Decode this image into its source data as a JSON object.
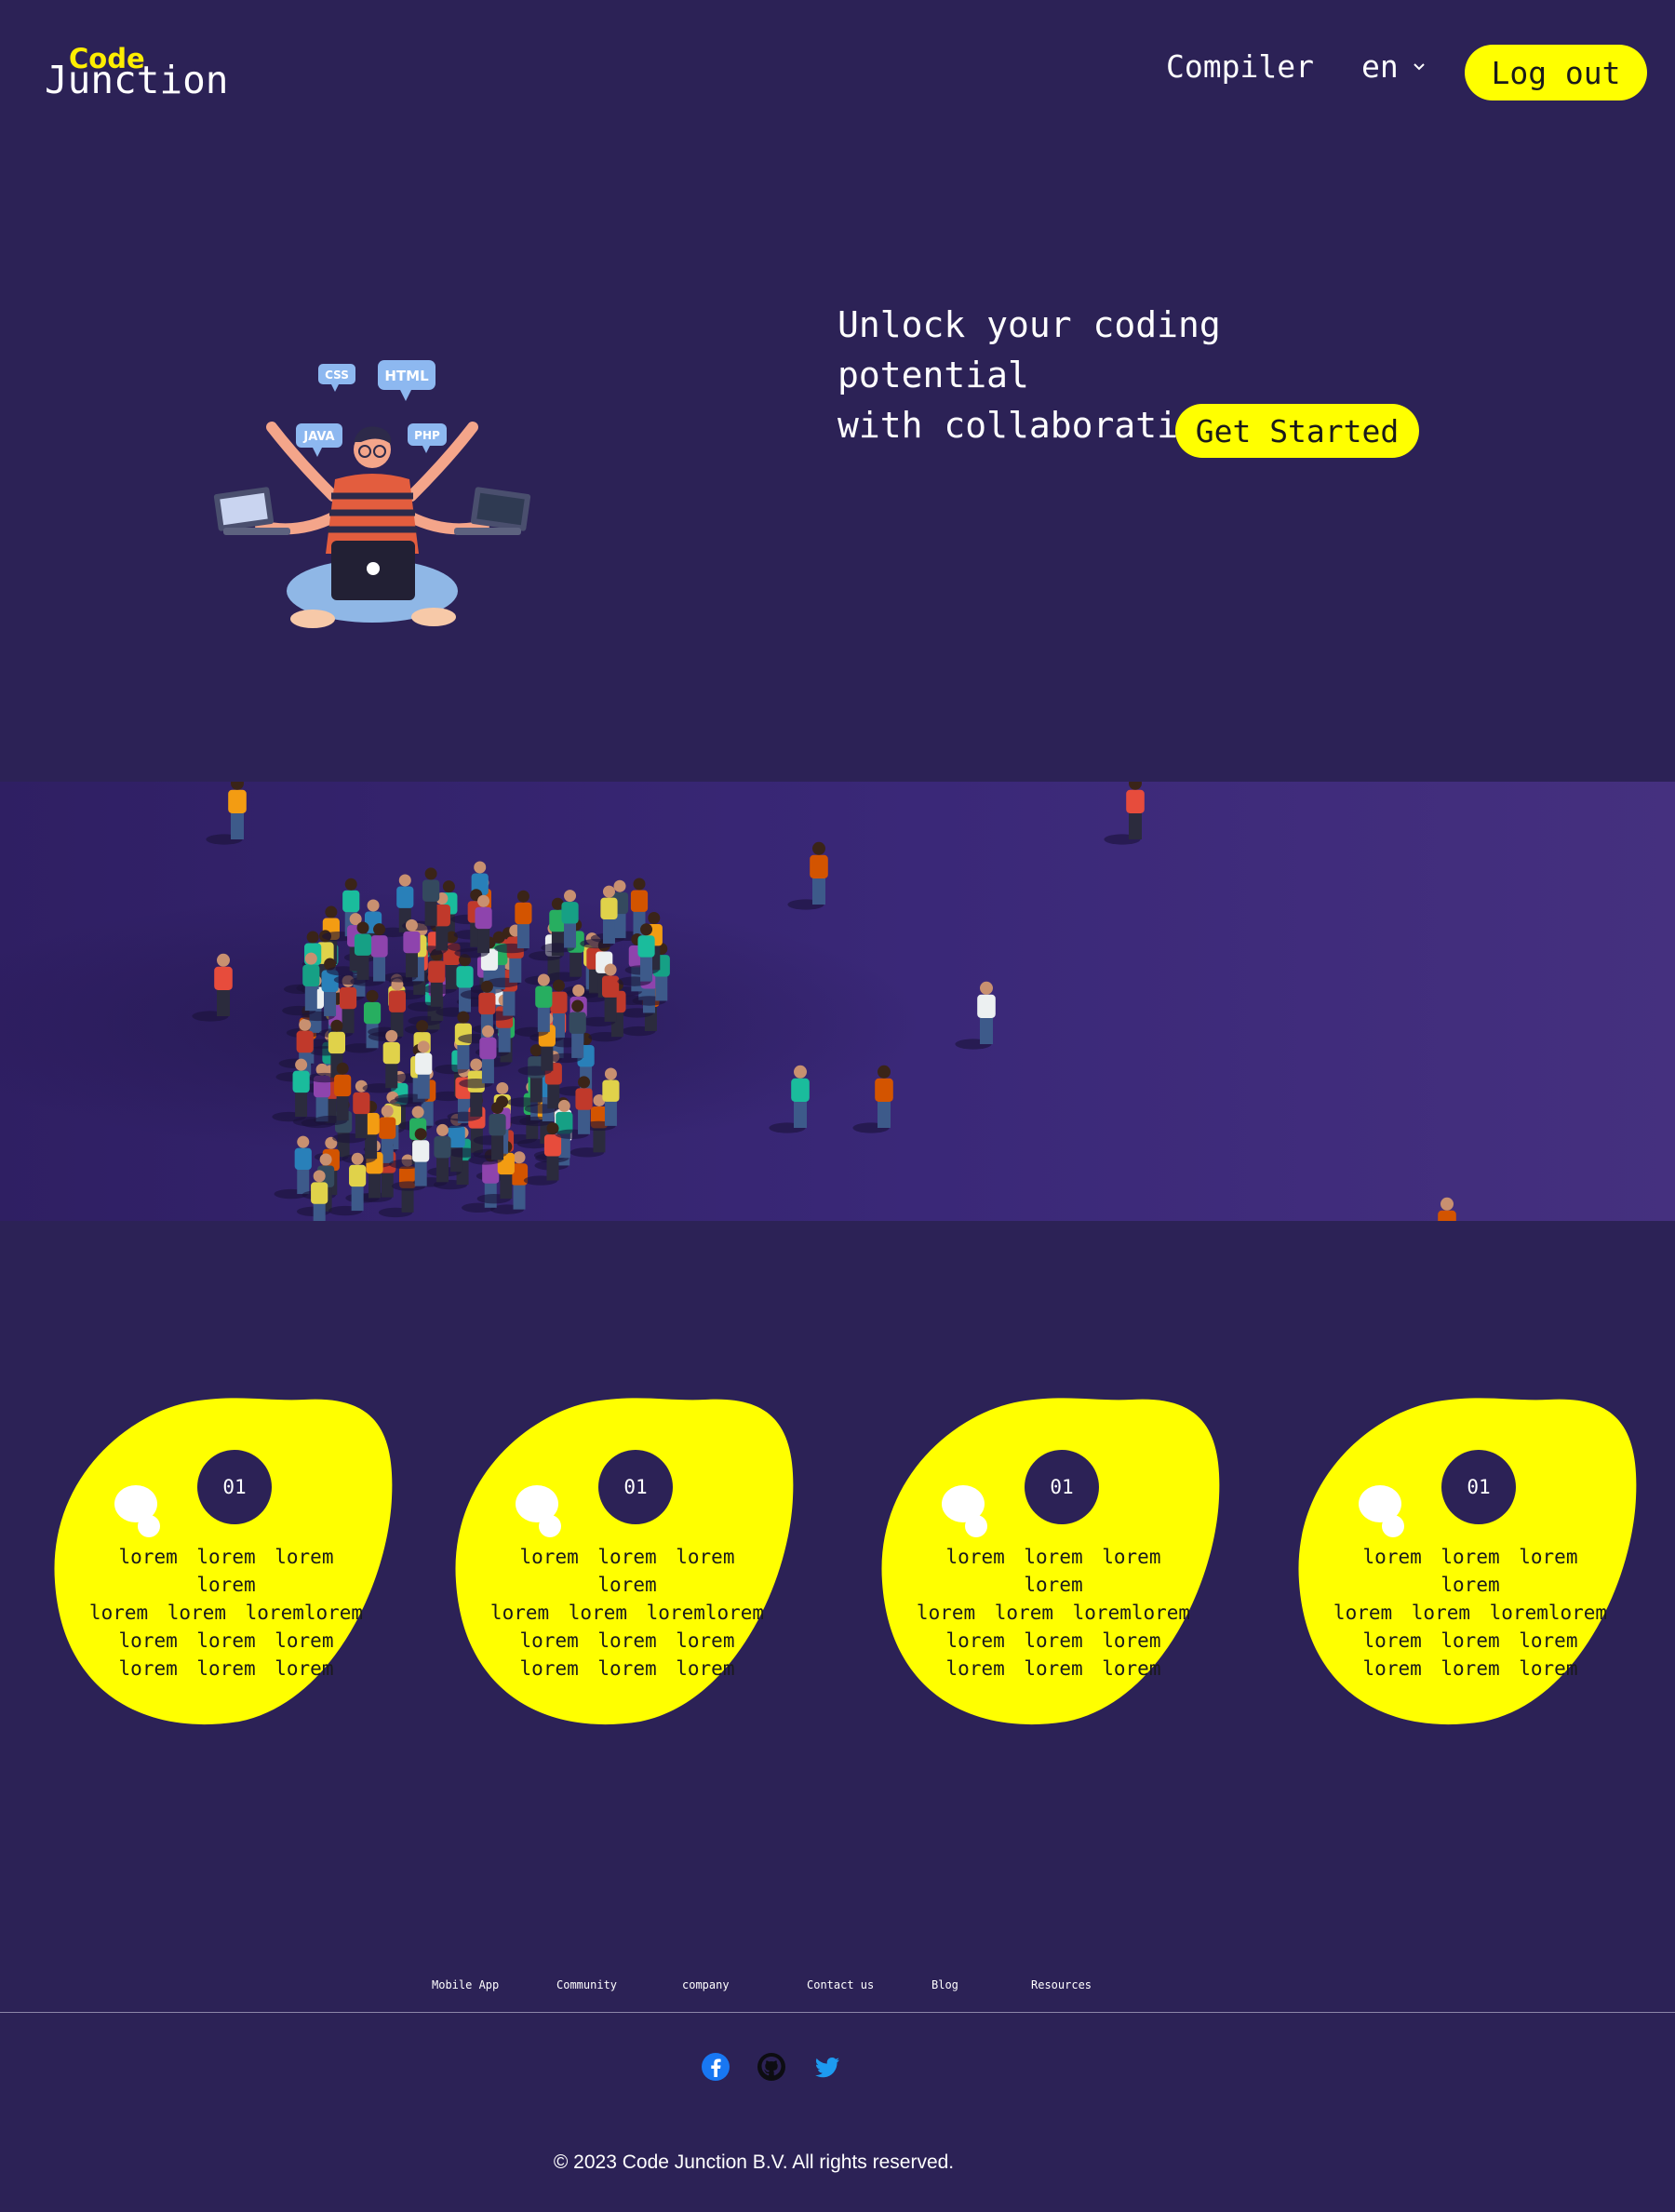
{
  "header": {
    "logo_top": "Code",
    "logo_bottom": "Junction",
    "nav_compiler": "Compiler",
    "language": "en",
    "logout_label": "Log out"
  },
  "hero": {
    "title_line1": "Unlock your coding potential",
    "title_line2": "with collaboration",
    "cta_label": "Get Started",
    "illustration_tags": [
      "CSS",
      "HTML",
      "JAVA",
      "PHP"
    ]
  },
  "cards": [
    {
      "number": "01",
      "lines": [
        "lorem lorem lorem lorem",
        "lorem lorem loremlorem",
        "lorem lorem lorem",
        "lorem lorem lorem"
      ]
    },
    {
      "number": "01",
      "lines": [
        "lorem lorem lorem lorem",
        "lorem lorem loremlorem",
        "lorem lorem lorem",
        "lorem lorem lorem"
      ]
    },
    {
      "number": "01",
      "lines": [
        "lorem lorem lorem lorem",
        "lorem lorem loremlorem",
        "lorem lorem lorem",
        "lorem lorem lorem"
      ]
    },
    {
      "number": "01",
      "lines": [
        "lorem lorem lorem lorem",
        "lorem lorem loremlorem",
        "lorem lorem lorem",
        "lorem lorem lorem"
      ]
    }
  ],
  "footer": {
    "links": [
      "Mobile App",
      "Community",
      "company",
      "Contact us",
      "Blog",
      "Resources"
    ],
    "socials": [
      "facebook-icon",
      "github-icon",
      "twitter-icon"
    ],
    "copyright": "© 2023 Code Junction B.V. All rights reserved."
  },
  "colors": {
    "background": "#2c2256",
    "accent": "#ffff00",
    "logo_accent": "#ffee00"
  }
}
